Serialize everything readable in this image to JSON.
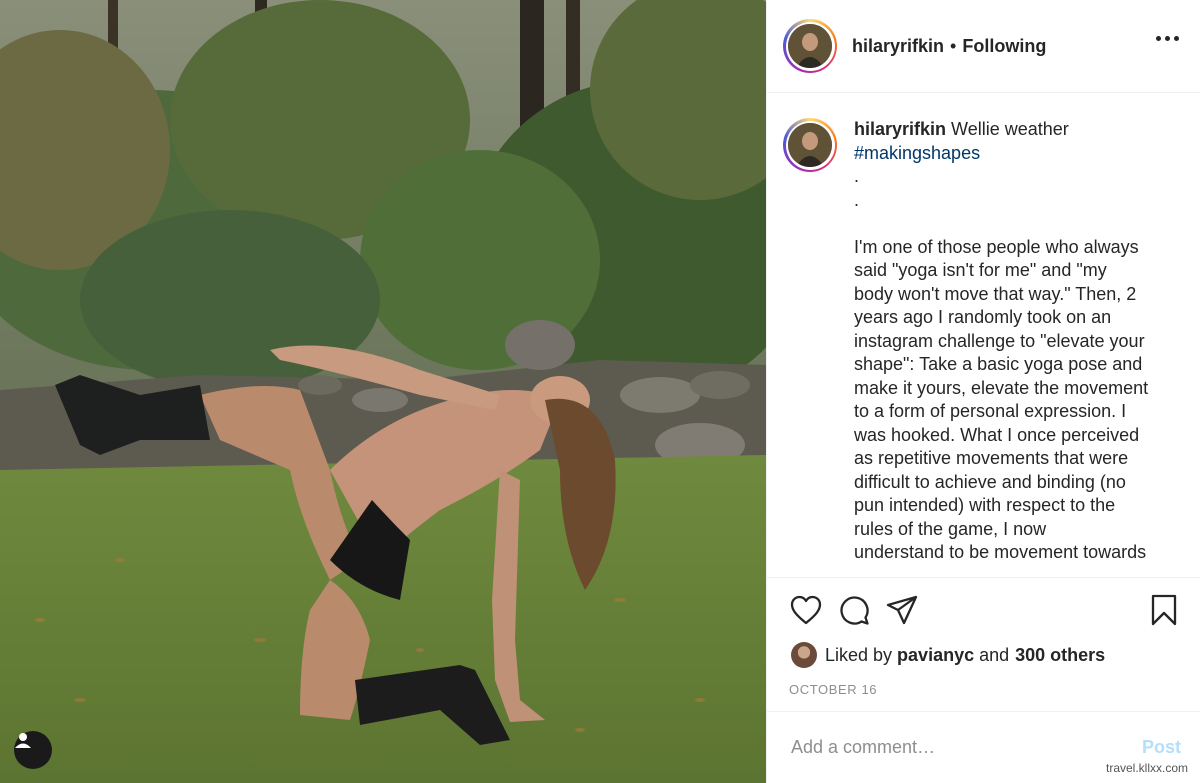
{
  "post": {
    "username": "hilaryrifkin",
    "separator": "•",
    "follow_status": "Following"
  },
  "caption": {
    "username": "hilaryrifkin",
    "title": "Wellie weather",
    "hashtag": "#makingshapes",
    "dot1": ".",
    "dot2": ".",
    "body_lines": [
      "I'm one of those people who always",
      "said \"yoga isn't for me\" and \"my",
      "body won't move that way.\" Then, 2",
      "years ago I randomly took on an",
      "instagram challenge to \"elevate your",
      "shape\": Take a basic yoga pose and",
      "make it yours, elevate the movement",
      "to a form of personal expression. I",
      "was hooked. What I once perceived",
      "as repetitive movements that were",
      "difficult to achieve and binding (no",
      "pun intended) with respect to the",
      "rules of the game, I now",
      "understand to be movement towards"
    ]
  },
  "likes": {
    "prefix": "Liked by",
    "liker": "pavianyc",
    "conjunction": "and",
    "others": "300 others"
  },
  "date": "OCTOBER 16",
  "comment": {
    "placeholder": "Add a comment…",
    "post_label": "Post"
  },
  "watermark": "travel.kllxx.com",
  "colors": {
    "hashtag": "#00376b",
    "post_disabled": "#b2dffc",
    "muted": "#8e8e8e",
    "text": "#262626"
  },
  "icons": {
    "like": "heart-icon",
    "comment": "comment-bubble-icon",
    "share": "paper-plane-icon",
    "save": "bookmark-icon",
    "more": "ellipsis-icon",
    "tags": "user-tag-icon"
  }
}
